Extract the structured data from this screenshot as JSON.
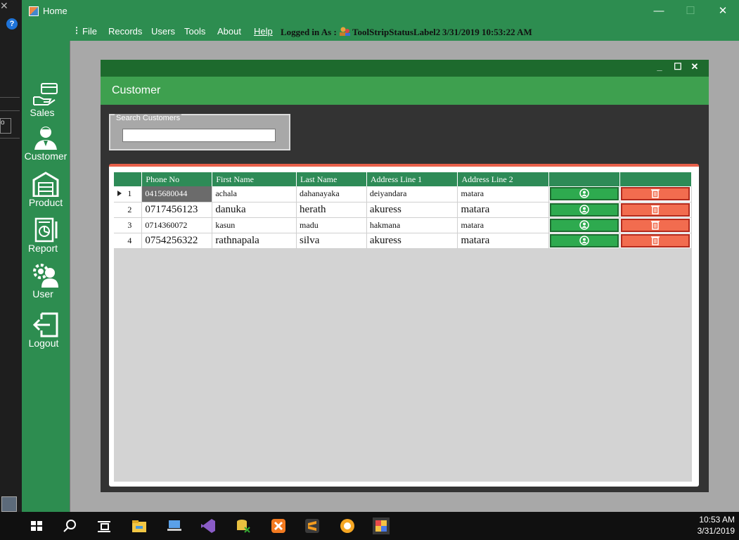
{
  "window": {
    "title": "Home"
  },
  "menu": {
    "items": [
      "File",
      "Records",
      "Users",
      "Tools",
      "About",
      "Help"
    ],
    "logged_in_label": "Logged in As :",
    "status_label": "ToolStripStatusLabel2",
    "datetime": "3/31/2019 10:53:22 AM"
  },
  "sidebar": {
    "items": [
      {
        "label": "Sales",
        "icon": "sales-icon"
      },
      {
        "label": "Customer",
        "icon": "customer-icon"
      },
      {
        "label": "Product",
        "icon": "product-icon"
      },
      {
        "label": "Report",
        "icon": "report-icon"
      },
      {
        "label": "User",
        "icon": "user-icon"
      },
      {
        "label": "Logout",
        "icon": "logout-icon"
      }
    ]
  },
  "customer_form": {
    "title": "Customer",
    "search": {
      "legend": "Search Customers",
      "value": "",
      "placeholder": ""
    },
    "columns": [
      "Phone No",
      "First  Name",
      "Last Name",
      "Address Line 1",
      "Address Line 2",
      "",
      ""
    ],
    "rows": [
      {
        "num": "1",
        "phone": "0415680044",
        "first": "achala",
        "last": "dahanayaka",
        "addr1": "deiyandara",
        "addr2": "matara"
      },
      {
        "num": "2",
        "phone": "0717456123",
        "first": "danuka",
        "last": "herath",
        "addr1": "akuress",
        "addr2": "matara"
      },
      {
        "num": "3",
        "phone": "0714360072",
        "first": "kasun",
        "last": "madu",
        "addr1": "hakmana",
        "addr2": "matara"
      },
      {
        "num": "4",
        "phone": "0754256322",
        "first": "rathnapala",
        "last": "silva",
        "addr1": "akuress",
        "addr2": "matara"
      }
    ]
  },
  "taskbar": {
    "time": "10:53 AM",
    "date": "3/31/2019"
  },
  "colors": {
    "green": "#2d8d50",
    "header_green": "#3ea04f",
    "edit_green": "#2eaa4f",
    "delete_red": "#f26c4f"
  }
}
